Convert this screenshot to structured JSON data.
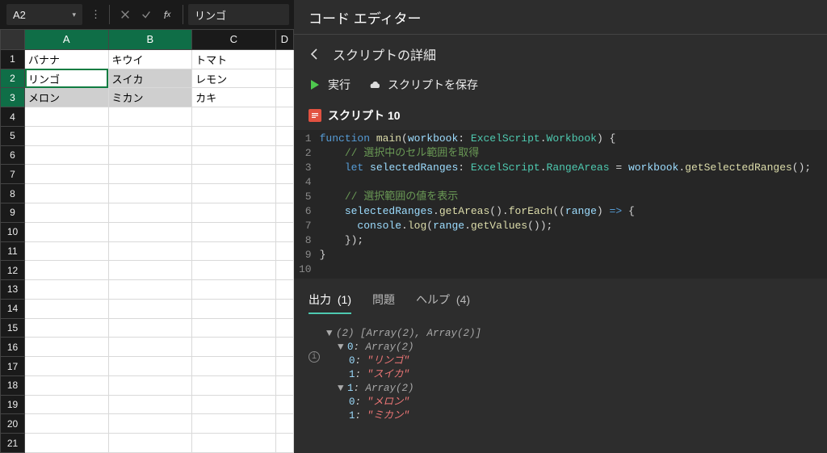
{
  "name_box": {
    "value": "A2"
  },
  "formula_bar": {
    "value": "リンゴ"
  },
  "columns": [
    "A",
    "B",
    "C",
    "D"
  ],
  "rows": [
    1,
    2,
    3,
    4,
    5,
    6,
    7,
    8,
    9,
    10,
    11,
    12,
    13,
    14,
    15,
    16,
    17,
    18,
    19,
    20,
    21
  ],
  "cells": {
    "r1": {
      "A": "バナナ",
      "B": "キウイ",
      "C": "トマト"
    },
    "r2": {
      "A": "リンゴ",
      "B": "スイカ",
      "C": "レモン"
    },
    "r3": {
      "A": "メロン",
      "B": "ミカン",
      "C": "カキ"
    }
  },
  "selection": {
    "cols": [
      "A",
      "B"
    ],
    "rows": [
      2,
      3
    ],
    "active_ref": "A2"
  },
  "editor": {
    "title": "コード エディター",
    "subtitle": "スクリプトの詳細",
    "toolbar": {
      "run": "実行",
      "save": "スクリプトを保存"
    },
    "script_label": "スクリプト",
    "script_number": "10",
    "code": {
      "lines": [
        {
          "n": 1,
          "segments": [
            [
              "kw",
              "function "
            ],
            [
              "fn",
              "main"
            ],
            [
              "pn",
              "("
            ],
            [
              "typ2",
              "workbook"
            ],
            [
              "op",
              ": "
            ],
            [
              "typ",
              "ExcelScript"
            ],
            [
              "op",
              "."
            ],
            [
              "typ",
              "Workbook"
            ],
            [
              "pn",
              ") {"
            ]
          ]
        },
        {
          "n": 2,
          "segments": [
            [
              "pn",
              "    "
            ],
            [
              "cm",
              "// 選択中のセル範囲を取得"
            ]
          ]
        },
        {
          "n": 3,
          "segments": [
            [
              "pn",
              "    "
            ],
            [
              "kw",
              "let "
            ],
            [
              "typ2",
              "selectedRanges"
            ],
            [
              "op",
              ": "
            ],
            [
              "typ",
              "ExcelScript"
            ],
            [
              "op",
              "."
            ],
            [
              "typ",
              "RangeAreas"
            ],
            [
              "op",
              " = "
            ],
            [
              "typ2",
              "workbook"
            ],
            [
              "op",
              "."
            ],
            [
              "fn",
              "getSelectedRanges"
            ],
            [
              "pn",
              "();"
            ]
          ]
        },
        {
          "n": 4,
          "segments": []
        },
        {
          "n": 5,
          "segments": [
            [
              "pn",
              "    "
            ],
            [
              "cm",
              "// 選択範囲の値を表示"
            ]
          ]
        },
        {
          "n": 6,
          "segments": [
            [
              "pn",
              "    "
            ],
            [
              "typ2",
              "selectedRanges"
            ],
            [
              "op",
              "."
            ],
            [
              "fn",
              "getAreas"
            ],
            [
              "pn",
              "()."
            ],
            [
              "fn",
              "forEach"
            ],
            [
              "pn",
              "(("
            ],
            [
              "typ2",
              "range"
            ],
            [
              "pn",
              ") "
            ],
            [
              "kw",
              "=>"
            ],
            [
              "pn",
              " {"
            ]
          ]
        },
        {
          "n": 7,
          "segments": [
            [
              "pn",
              "      "
            ],
            [
              "typ2",
              "console"
            ],
            [
              "op",
              "."
            ],
            [
              "fn",
              "log"
            ],
            [
              "pn",
              "("
            ],
            [
              "typ2",
              "range"
            ],
            [
              "op",
              "."
            ],
            [
              "fn",
              "getValues"
            ],
            [
              "pn",
              "());"
            ]
          ]
        },
        {
          "n": 8,
          "segments": [
            [
              "pn",
              "    });"
            ]
          ]
        },
        {
          "n": 9,
          "segments": [
            [
              "pn",
              "}"
            ]
          ]
        },
        {
          "n": 10,
          "segments": []
        }
      ]
    },
    "tabs": {
      "output": {
        "label": "出力",
        "count": "(1)"
      },
      "problems": {
        "label": "問題"
      },
      "help": {
        "label": "ヘルプ",
        "count": "(4)"
      }
    },
    "output": {
      "header": "(2) [Array(2), Array(2)]",
      "items": [
        {
          "idx": "0",
          "shape": "Array(2)",
          "vals": [
            {
              "i": "0",
              "v": "\"リンゴ\""
            },
            {
              "i": "1",
              "v": "\"スイカ\""
            }
          ]
        },
        {
          "idx": "1",
          "shape": "Array(2)",
          "vals": [
            {
              "i": "0",
              "v": "\"メロン\""
            },
            {
              "i": "1",
              "v": "\"ミカン\""
            }
          ]
        }
      ]
    }
  }
}
